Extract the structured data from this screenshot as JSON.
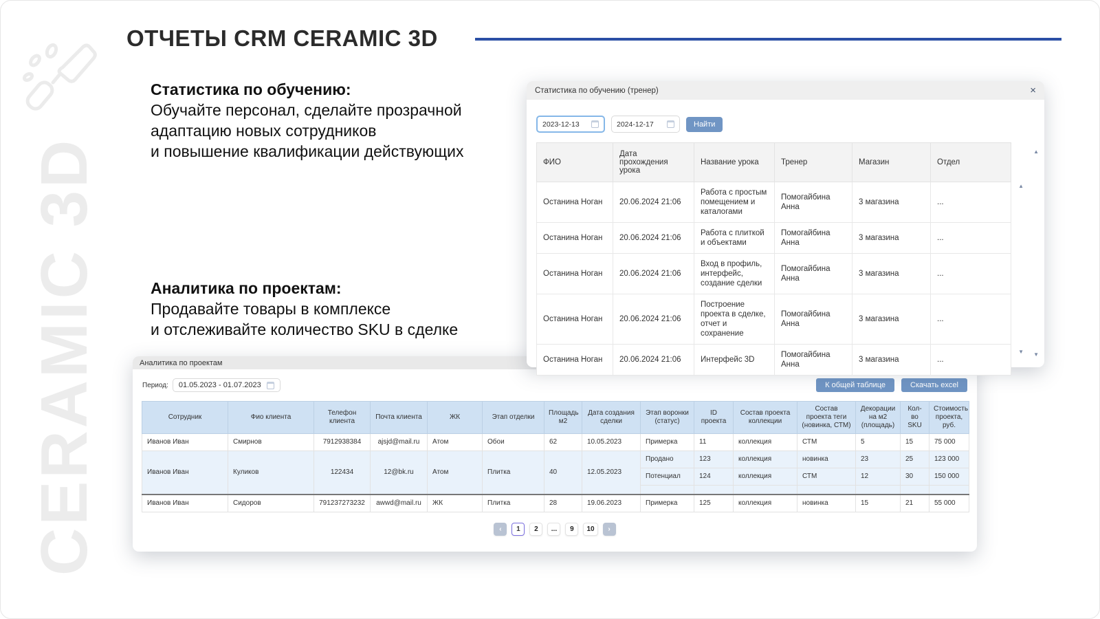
{
  "slide": {
    "title": "ОТЧЕТЫ CRM CERAMIC 3D",
    "watermark_text": "CERAMIC 3D",
    "accent_color": "#2b4fa5"
  },
  "intro_training": {
    "heading": "Статистика по обучению:",
    "line1": "Обучайте персонал, сделайте прозрачной",
    "line2": "адаптацию новых сотрудников",
    "line3": "и повышение квалификации действующих"
  },
  "intro_projects": {
    "heading": "Аналитика по проектам:",
    "line1": "Продавайте товары в комплексе",
    "line2": "и отслеживайте количество SKU в сделке"
  },
  "icons": {
    "close": "×",
    "scroll_up": "▲",
    "scroll_down": "▼",
    "prev": "‹",
    "next": "›"
  },
  "training_window": {
    "title": "Статистика по обучению (тренер)",
    "date_from": "2023-12-13",
    "date_to": "2024-12-17",
    "search_button": "Найти",
    "columns": [
      "ФИО",
      "Дата прохождения урока",
      "Название урока",
      "Тренер",
      "Магазин",
      "Отдел"
    ],
    "rows": [
      [
        "Останина Ноган",
        "20.06.2024 21:06",
        "Работа с простым помещением и каталогами",
        "Помогайбина Анна",
        "3 магазина",
        "..."
      ],
      [
        "Останина Ноган",
        "20.06.2024 21:06",
        "Работа с плиткой и объектами",
        "Помогайбина Анна",
        "3 магазина",
        "..."
      ],
      [
        "Останина Ноган",
        "20.06.2024 21:06",
        "Вход в профиль, интерфейс, создание сделки",
        "Помогайбина Анна",
        "3 магазина",
        "..."
      ],
      [
        "Останина Ноган",
        "20.06.2024 21:06",
        "Построение проекта в сделке, отчет и сохранение",
        "Помогайбина Анна",
        "3 магазина",
        "..."
      ],
      [
        "Останина Ноган",
        "20.06.2024 21:06",
        "Интерфейс 3D",
        "Помогайбина Анна",
        "3 магазина",
        "..."
      ]
    ]
  },
  "projects_window": {
    "title": "Аналитика по проектам",
    "period_label": "Период:",
    "period_value": "01.05.2023 - 01.07.2023",
    "btn_common_table": "К общей таблице",
    "btn_download": "Скачать excel",
    "columns": [
      "Сотрудник",
      "Фио клиента",
      "Телефон клиента",
      "Почта клиента",
      "ЖК",
      "Этап отделки",
      "Площадь м2",
      "Дата создания сделки",
      "Этап воронки (статус)",
      "ID проекта",
      "Состав проекта коллекции",
      "Состав проекта теги (новинка, СТМ)",
      "Декорации на м2 (площадь)",
      "Кол-во SKU",
      "Стоимость проекта, руб."
    ],
    "row1": [
      "Иванов Иван",
      "Смирнов",
      "7912938384",
      "ajsjd@mail.ru",
      "Атом",
      "Обои",
      "62",
      "10.05.2023",
      "Примерка",
      "11",
      "коллекция",
      "СТМ",
      "5",
      "15",
      "75 000"
    ],
    "row2_left": [
      "Иванов Иван",
      "Куликов",
      "122434",
      "12@bk.ru",
      "Атом",
      "Плитка",
      "40",
      "12.05.2023"
    ],
    "row2_sub1": [
      "Продано",
      "123",
      "коллекция",
      "новинка",
      "23",
      "25",
      "123 000"
    ],
    "row2_sub2": [
      "Потенциал",
      "124",
      "коллекция",
      "СТМ",
      "12",
      "30",
      "150 000"
    ],
    "row3": [
      "Иванов Иван",
      "Сидоров",
      "791237273232",
      "awwd@mail.ru",
      "ЖК",
      "Плитка",
      "28",
      "19.06.2023",
      "Примерка",
      "125",
      "коллекция",
      "новинка",
      "15",
      "21",
      "55 000"
    ],
    "pagination": {
      "pages": [
        "1",
        "2",
        "...",
        "9",
        "10"
      ],
      "active_page": "1"
    }
  }
}
